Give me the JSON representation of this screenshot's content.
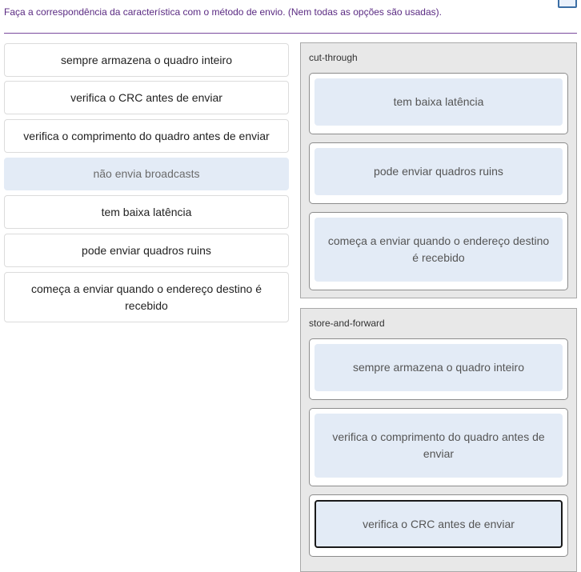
{
  "instruction": "Faça a correspondência da característica com o método de envio. (Nem todas as opções são usadas).",
  "options": [
    {
      "label": "sempre armazena o quadro inteiro"
    },
    {
      "label": "verifica o CRC antes de enviar"
    },
    {
      "label": "verifica o comprimento do quadro antes de enviar"
    },
    {
      "label": "não envia broadcasts"
    },
    {
      "label": "tem baixa latência"
    },
    {
      "label": "pode enviar quadros ruins"
    },
    {
      "label": "começa a enviar quando o endereço destino é recebido"
    }
  ],
  "groups": [
    {
      "title": "cut-through",
      "slots": [
        {
          "label": "tem baixa latência"
        },
        {
          "label": "pode enviar quadros ruins"
        },
        {
          "label": "começa a enviar quando o endereço destino é recebido"
        }
      ]
    },
    {
      "title": "store-and-forward",
      "slots": [
        {
          "label": "sempre armazena o quadro inteiro"
        },
        {
          "label": "verifica o comprimento do quadro antes de enviar"
        },
        {
          "label": "verifica o CRC antes de enviar"
        }
      ]
    }
  ]
}
